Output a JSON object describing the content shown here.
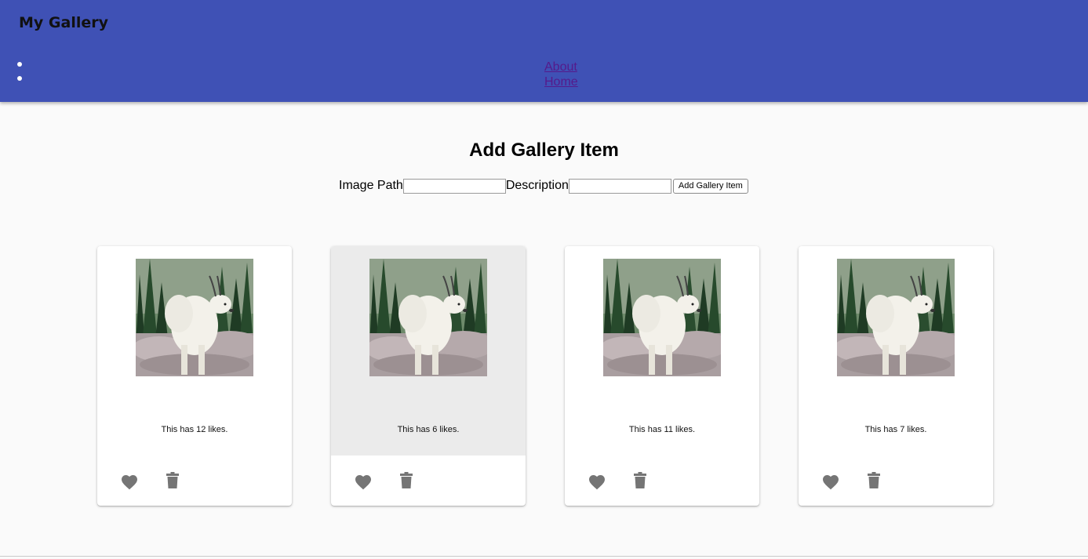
{
  "app": {
    "title": "My Gallery"
  },
  "nav": {
    "links": [
      "About",
      "Home"
    ]
  },
  "form": {
    "title": "Add Gallery Item",
    "image_path_label": "Image Path",
    "image_path_value": "",
    "description_label": "Description",
    "description_value": "",
    "submit_label": "Add Gallery Item"
  },
  "gallery": {
    "items": [
      {
        "likes_text": "This has 12 likes.",
        "image": "mountain-goat-photo"
      },
      {
        "likes_text": "This has 6 likes.",
        "image": "mountain-goat-photo"
      },
      {
        "likes_text": "This has 11 likes.",
        "image": "mountain-goat-photo"
      },
      {
        "likes_text": "This has 7 likes.",
        "image": "mountain-goat-photo"
      }
    ]
  },
  "icons": {
    "like": "heart-icon",
    "delete": "trash-icon"
  },
  "colors": {
    "appbar": "#3f51b5",
    "icon": "#757575",
    "hover_card": "#ebebeb"
  }
}
